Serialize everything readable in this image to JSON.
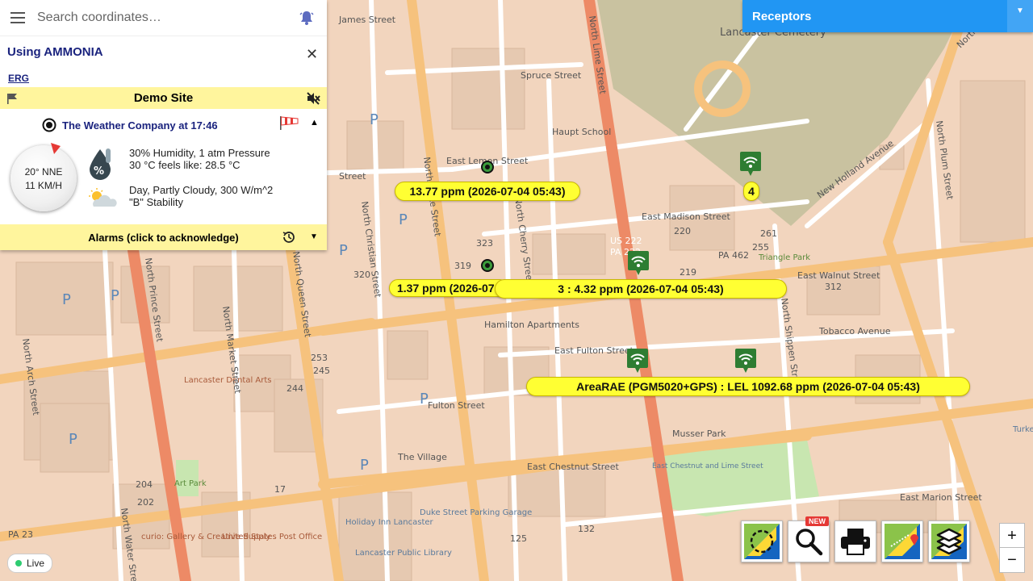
{
  "search": {
    "placeholder": "Search coordinates…"
  },
  "chemical": {
    "label": "Using AMMONIA",
    "erg_link": "ERG"
  },
  "site": {
    "name": "Demo Site"
  },
  "weather": {
    "title": "The Weather Company at 17:46",
    "wind_direction": "20° NNE",
    "wind_speed": "11 KM/H",
    "line1": "30% Humidity, 1 atm Pressure",
    "line2": "30 °C feels like: 28.5 °C",
    "line3": "Day, Partly Cloudy, 300 W/m^2",
    "line4": "\"B\" Stability"
  },
  "alarms": {
    "label": "Alarms (click to acknowledge)"
  },
  "receptors": {
    "label": "Receptors"
  },
  "map": {
    "tags": [
      {
        "text": "13.77 ppm (2026-07-04 05:43)"
      },
      {
        "text": "1.37 ppm (2026-07"
      },
      {
        "text": "3 : 4.32 ppm (2026-07-04 05:43)"
      },
      {
        "text": "AreaRAE (PGM5020+GPS) : LEL 1092.68 ppm (2026-07-04 05:43)"
      },
      {
        "text": "4"
      }
    ],
    "streets": [
      "James Street",
      "Spruce Street",
      "East Lemon Street",
      "North Duke Street",
      "North Lime Street",
      "Lancaster Cemetery",
      "Haupt School",
      "East Madison Street",
      "New Holland Avenue",
      "North Plum Street",
      "North Christian Street",
      "North Cherry Street",
      "East Walnut Street",
      "Hamilton Apartments",
      "East Fulton Street",
      "Tobacco Avenue",
      "North Shippen Street",
      "Fulton Street",
      "Lancaster Dental Arts",
      "North Market Street",
      "North Prince Street",
      "North Queen Street",
      "North Arch Street",
      "North Water Street",
      "The Village",
      "East Chestnut Street",
      "Musser Park",
      "East Chestnut and Lime Street",
      "East Marion Street",
      "Art Park",
      "Holiday Inn Lancaster",
      "Duke Street Parking Garage",
      "Lancaster Public Library",
      "United States Post Office",
      "curio: Gallery & Creative Supply",
      "Triangle Park",
      "US 222",
      "PA 222",
      "PA 23",
      "PA 462",
      "Street",
      "North Holland",
      "Turkey Hill"
    ],
    "numbers": [
      "323",
      "319",
      "320",
      "220",
      "219",
      "255",
      "261",
      "312",
      "253",
      "245",
      "244",
      "204",
      "202",
      "17",
      "125",
      "132"
    ]
  },
  "toolbar": {
    "new_badge": "NEW"
  },
  "zoom": {
    "in": "+",
    "out": "−"
  },
  "status": {
    "live": "Live"
  },
  "colors": {
    "accent": "#2196f3",
    "tag": "#ffff33",
    "panel_highlight": "#fff59d",
    "sensor": "#2e7d32"
  }
}
